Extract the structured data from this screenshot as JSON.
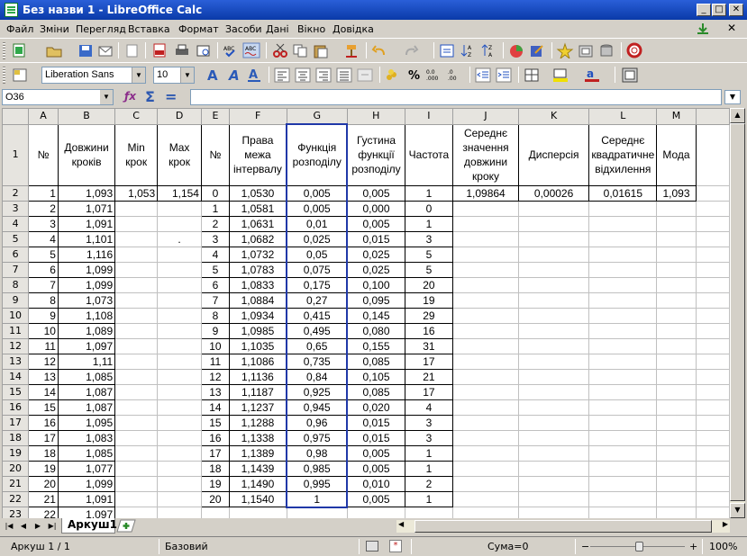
{
  "window": {
    "title": "Без назви 1 - LibreOffice Calc",
    "minimize": "_",
    "maximize": "□",
    "close": "✕"
  },
  "menu": [
    {
      "label": "Файл"
    },
    {
      "label": "Зміни"
    },
    {
      "label": "Перегляд"
    },
    {
      "label": "Вставка"
    },
    {
      "label": "Формат"
    },
    {
      "label": "Засоби"
    },
    {
      "label": "Дані"
    },
    {
      "label": "Вікно"
    },
    {
      "label": "Довідка"
    }
  ],
  "formatting": {
    "font_name": "Liberation Sans",
    "font_size": "10"
  },
  "formula_bar": {
    "cell_ref": "O36",
    "formula": ""
  },
  "columns": [
    "A",
    "B",
    "C",
    "D",
    "E",
    "F",
    "G",
    "H",
    "I",
    "J",
    "K",
    "L",
    "M"
  ],
  "header_row": {
    "row_num": "1",
    "cells": [
      "№",
      "Довжини кроків",
      "Min крок",
      "Max крок",
      "№",
      "Права межа інтервалу",
      "Функція розподілу",
      "Густина функції розподілу",
      "Частота",
      "Середнє значення довжини кроку",
      "Дисперсія",
      "Середнє квадратичне відхилення",
      "Мода"
    ]
  },
  "rows": [
    {
      "n": "2",
      "a": "1",
      "b": "1,093",
      "c": "1,053",
      "d": "1,154",
      "e": "0",
      "f": "1,0530",
      "g": "0,005",
      "h": "0,005",
      "i": "1",
      "j": "1,09864",
      "k": "0,00026",
      "l": "0,01615",
      "m": "1,093"
    },
    {
      "n": "3",
      "a": "2",
      "b": "1,071",
      "c": "",
      "d": "",
      "e": "1",
      "f": "1,0581",
      "g": "0,005",
      "h": "0,000",
      "i": "0",
      "j": "",
      "k": "",
      "l": "",
      "m": ""
    },
    {
      "n": "4",
      "a": "3",
      "b": "1,091",
      "c": "",
      "d": "",
      "e": "2",
      "f": "1,0631",
      "g": "0,01",
      "h": "0,005",
      "i": "1",
      "j": "",
      "k": "",
      "l": "",
      "m": ""
    },
    {
      "n": "5",
      "a": "4",
      "b": "1,101",
      "c": "",
      "d": ".",
      "e": "3",
      "f": "1,0682",
      "g": "0,025",
      "h": "0,015",
      "i": "3",
      "j": "",
      "k": "",
      "l": "",
      "m": ""
    },
    {
      "n": "6",
      "a": "5",
      "b": "1,116",
      "c": "",
      "d": "",
      "e": "4",
      "f": "1,0732",
      "g": "0,05",
      "h": "0,025",
      "i": "5",
      "j": "",
      "k": "",
      "l": "",
      "m": ""
    },
    {
      "n": "7",
      "a": "6",
      "b": "1,099",
      "c": "",
      "d": "",
      "e": "5",
      "f": "1,0783",
      "g": "0,075",
      "h": "0,025",
      "i": "5",
      "j": "",
      "k": "",
      "l": "",
      "m": ""
    },
    {
      "n": "8",
      "a": "7",
      "b": "1,099",
      "c": "",
      "d": "",
      "e": "6",
      "f": "1,0833",
      "g": "0,175",
      "h": "0,100",
      "i": "20",
      "j": "",
      "k": "",
      "l": "",
      "m": ""
    },
    {
      "n": "9",
      "a": "8",
      "b": "1,073",
      "c": "",
      "d": "",
      "e": "7",
      "f": "1,0884",
      "g": "0,27",
      "h": "0,095",
      "i": "19",
      "j": "",
      "k": "",
      "l": "",
      "m": ""
    },
    {
      "n": "10",
      "a": "9",
      "b": "1,108",
      "c": "",
      "d": "",
      "e": "8",
      "f": "1,0934",
      "g": "0,415",
      "h": "0,145",
      "i": "29",
      "j": "",
      "k": "",
      "l": "",
      "m": ""
    },
    {
      "n": "11",
      "a": "10",
      "b": "1,089",
      "c": "",
      "d": "",
      "e": "9",
      "f": "1,0985",
      "g": "0,495",
      "h": "0,080",
      "i": "16",
      "j": "",
      "k": "",
      "l": "",
      "m": ""
    },
    {
      "n": "12",
      "a": "11",
      "b": "1,097",
      "c": "",
      "d": "",
      "e": "10",
      "f": "1,1035",
      "g": "0,65",
      "h": "0,155",
      "i": "31",
      "j": "",
      "k": "",
      "l": "",
      "m": ""
    },
    {
      "n": "13",
      "a": "12",
      "b": "1,11",
      "c": "",
      "d": "",
      "e": "11",
      "f": "1,1086",
      "g": "0,735",
      "h": "0,085",
      "i": "17",
      "j": "",
      "k": "",
      "l": "",
      "m": ""
    },
    {
      "n": "14",
      "a": "13",
      "b": "1,085",
      "c": "",
      "d": "",
      "e": "12",
      "f": "1,1136",
      "g": "0,84",
      "h": "0,105",
      "i": "21",
      "j": "",
      "k": "",
      "l": "",
      "m": ""
    },
    {
      "n": "15",
      "a": "14",
      "b": "1,087",
      "c": "",
      "d": "",
      "e": "13",
      "f": "1,1187",
      "g": "0,925",
      "h": "0,085",
      "i": "17",
      "j": "",
      "k": "",
      "l": "",
      "m": ""
    },
    {
      "n": "16",
      "a": "15",
      "b": "1,087",
      "c": "",
      "d": "",
      "e": "14",
      "f": "1,1237",
      "g": "0,945",
      "h": "0,020",
      "i": "4",
      "j": "",
      "k": "",
      "l": "",
      "m": ""
    },
    {
      "n": "17",
      "a": "16",
      "b": "1,095",
      "c": "",
      "d": "",
      "e": "15",
      "f": "1,1288",
      "g": "0,96",
      "h": "0,015",
      "i": "3",
      "j": "",
      "k": "",
      "l": "",
      "m": ""
    },
    {
      "n": "18",
      "a": "17",
      "b": "1,083",
      "c": "",
      "d": "",
      "e": "16",
      "f": "1,1338",
      "g": "0,975",
      "h": "0,015",
      "i": "3",
      "j": "",
      "k": "",
      "l": "",
      "m": ""
    },
    {
      "n": "19",
      "a": "18",
      "b": "1,085",
      "c": "",
      "d": "",
      "e": "17",
      "f": "1,1389",
      "g": "0,98",
      "h": "0,005",
      "i": "1",
      "j": "",
      "k": "",
      "l": "",
      "m": ""
    },
    {
      "n": "20",
      "a": "19",
      "b": "1,077",
      "c": "",
      "d": "",
      "e": "18",
      "f": "1,1439",
      "g": "0,985",
      "h": "0,005",
      "i": "1",
      "j": "",
      "k": "",
      "l": "",
      "m": ""
    },
    {
      "n": "21",
      "a": "20",
      "b": "1,099",
      "c": "",
      "d": "",
      "e": "19",
      "f": "1,1490",
      "g": "0,995",
      "h": "0,010",
      "i": "2",
      "j": "",
      "k": "",
      "l": "",
      "m": ""
    },
    {
      "n": "22",
      "a": "21",
      "b": "1,091",
      "c": "",
      "d": "",
      "e": "20",
      "f": "1,1540",
      "g": "1",
      "h": "0,005",
      "i": "1",
      "j": "",
      "k": "",
      "l": "",
      "m": ""
    },
    {
      "n": "23",
      "a": "22",
      "b": "1,097",
      "c": "",
      "d": "",
      "e": "",
      "f": "",
      "g": "",
      "h": "",
      "i": "",
      "j": "",
      "k": "",
      "l": "",
      "m": ""
    }
  ],
  "sheet_tab": "Аркуш1",
  "status": {
    "sheet": "Аркуш 1 / 1",
    "style": "Базовий",
    "sum": "Сума=0",
    "zoom": "100%",
    "zoom_minus": "−",
    "zoom_plus": "+"
  },
  "colors": {
    "titlebar": "#0a3aa8",
    "selection": "#2038a8"
  }
}
